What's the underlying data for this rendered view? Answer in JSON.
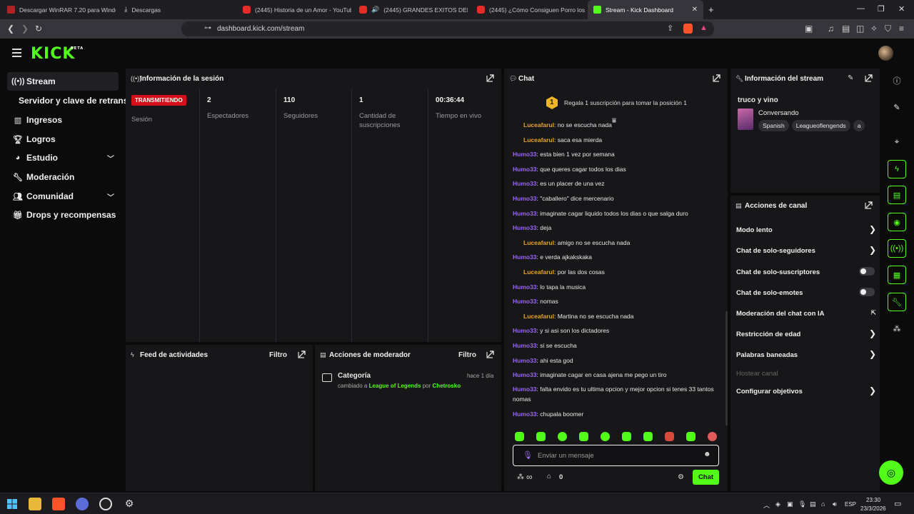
{
  "browser": {
    "tabs": [
      {
        "title": "Descargar WinRAR 7.20 para Window",
        "favicon_color": "#b22222"
      },
      {
        "title": "Descargas",
        "favicon_color": "#cccccc"
      },
      {
        "title": "(2445) Historia de un Amor - YouTub",
        "favicon_color": "#ff0000"
      },
      {
        "title": "(2445) GRANDES EXITOS DEL INC",
        "favicon_color": "#ff0000"
      },
      {
        "title": "(2445) ¿Cómo Consiguen Porro los A",
        "favicon_color": "#ff0000"
      },
      {
        "title": "Stream - Kick Dashboard",
        "favicon_color": "#53fc18"
      }
    ],
    "new_tab": "+",
    "url": "dashboard.kick.com/stream"
  },
  "app": {
    "logo": "KICK",
    "logo_badge": "BETA",
    "accent": "#53fc18"
  },
  "sidebar": {
    "items": [
      {
        "label": "Stream",
        "icon": "broadcast-icon"
      },
      {
        "label": "Servidor y clave de retransm",
        "icon": ""
      },
      {
        "label": "Ingresos",
        "icon": "chart-icon"
      },
      {
        "label": "Logros",
        "icon": "trophy-icon"
      },
      {
        "label": "Estudio",
        "icon": "palette-icon"
      },
      {
        "label": "Moderación",
        "icon": "wrench-icon"
      },
      {
        "label": "Comunidad",
        "icon": "users-icon"
      },
      {
        "label": "Drops y recompensas",
        "icon": "gift-icon"
      }
    ]
  },
  "session": {
    "title": "Información de la sesión",
    "status_badge": "TRANSMITIENDO",
    "session_label": "Sesión",
    "stats": [
      {
        "value": "2",
        "label": "Espectadores"
      },
      {
        "value": "110",
        "label": "Seguidores"
      },
      {
        "value": "1",
        "label": "Cantidad de suscripciones"
      },
      {
        "value": "00:36:44",
        "label": "Tiempo en vivo"
      }
    ]
  },
  "feed": {
    "title": "Feed de actividades",
    "filter": "Filtro"
  },
  "modactions": {
    "title": "Acciones de moderador",
    "filter": "Filtro",
    "entry": {
      "title": "Categoría",
      "time": "hace 1 día",
      "pre": "cambiado a",
      "value": "League of Legends",
      "by": "por",
      "user": "Chetrosko"
    }
  },
  "chat": {
    "title": "Chat",
    "gift_rank": "1",
    "gift_text": "Regala 1 suscripción para tomar la posición 1",
    "messages": [
      {
        "user": "Luceafarul",
        "text": ": no se escucha nada",
        "reply": true
      },
      {
        "user": "Luceafarul",
        "text": ": saca esa mierda",
        "reply": true
      },
      {
        "user": "Humo33",
        "text": ": esta bien 1 vez por semana",
        "reply": false
      },
      {
        "user": "Humo33",
        "text": ": que queres cagar todos los dias",
        "reply": false
      },
      {
        "user": "Humo33",
        "text": ": es un placer de una vez",
        "reply": false
      },
      {
        "user": "Humo33",
        "text": ": \"caballero\" dice mercenario",
        "reply": false
      },
      {
        "user": "Humo33",
        "text": ": imaginate cagar liquido todos los dias o que salga duro",
        "reply": false
      },
      {
        "user": "Humo33",
        "text": ": deja",
        "reply": false
      },
      {
        "user": "Luceafarul",
        "text": ": amigo no se escucha nada",
        "reply": true
      },
      {
        "user": "Humo33",
        "text": ": e verda ajkakskaka",
        "reply": false
      },
      {
        "user": "Luceafarul",
        "text": ": por las dos cosas",
        "reply": true
      },
      {
        "user": "Humo33",
        "text": ": lo tapa la musica",
        "reply": false
      },
      {
        "user": "Humo33",
        "text": ": nomas",
        "reply": false
      },
      {
        "user": "Luceafarul",
        "text": ": Martina no se escucha nada",
        "reply": true
      },
      {
        "user": "Humo33",
        "text": ": y si asi son los dictadores",
        "reply": false
      },
      {
        "user": "Humo33",
        "text": ": si se escucha",
        "reply": false
      },
      {
        "user": "Humo33",
        "text": ": ahi esta god",
        "reply": false
      },
      {
        "user": "Humo33",
        "text": ": imaginate cagar en casa ajena me pego un tiro",
        "reply": false
      },
      {
        "user": "Humo33",
        "text": ": falta envido es tu ultima opcion y mejor opcion si tenes 33 tantos nomas",
        "reply": false
      },
      {
        "user": "Humo33",
        "text": ": chupala boomer",
        "reply": false
      }
    ],
    "input_placeholder": "Enviar un mensaje",
    "points": "0",
    "send": "Chat",
    "infinity": "∞"
  },
  "stream_info": {
    "title": "Información del stream",
    "stream_title": "truco y vino",
    "category": "Conversando",
    "tags": [
      "Spanish",
      "Leagueoflengends",
      "a"
    ]
  },
  "channel_actions": {
    "title": "Acciones de canal",
    "items": [
      {
        "label": "Modo lento",
        "control": "arrow"
      },
      {
        "label": "Chat de solo-seguidores",
        "control": "arrow"
      },
      {
        "label": "Chat de solo-suscriptores",
        "control": "toggle"
      },
      {
        "label": "Chat de solo-emotes",
        "control": "toggle"
      },
      {
        "label": "Moderación del chat con IA",
        "control": "external"
      },
      {
        "label": "Restricción de edad",
        "control": "arrow"
      },
      {
        "label": "Palabras baneadas",
        "control": "arrow"
      },
      {
        "label": "Hostear canal",
        "control": "none"
      },
      {
        "label": "Configurar objetivos",
        "control": "arrow"
      }
    ]
  },
  "taskbar": {
    "lang": "ESP",
    "time": "23:30",
    "date": "23/3/2026"
  }
}
